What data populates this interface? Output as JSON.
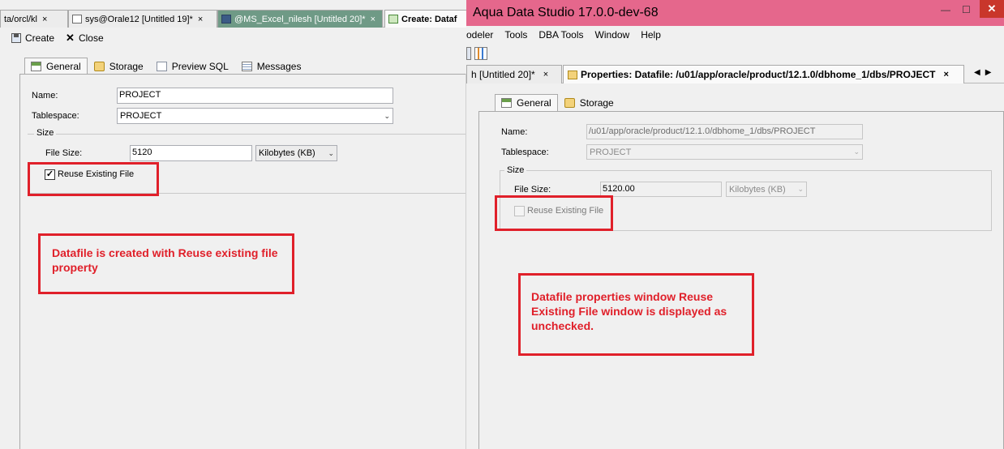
{
  "left": {
    "doc_tabs": [
      {
        "label": "ta/orcl/kl",
        "close": "×"
      },
      {
        "label": "sys@Orale12 [Untitled 19]*",
        "close": "×"
      },
      {
        "label": "@MS_Excel_nilesh [Untitled 20]*",
        "close": "×"
      },
      {
        "label": "Create: Dataf"
      }
    ],
    "toolbar": {
      "create_label": "Create",
      "close_label": "Close"
    },
    "tabs": [
      "General",
      "Storage",
      "Preview SQL",
      "Messages"
    ],
    "form": {
      "name_label": "Name:",
      "name_value": "PROJECT",
      "tablespace_label": "Tablespace:",
      "tablespace_value": "PROJECT",
      "size_legend": "Size",
      "file_size_label": "File Size:",
      "file_size_value": "5120",
      "unit_value": "Kilobytes (KB)",
      "reuse_label": "Reuse Existing File",
      "reuse_checked": true,
      "check_glyph": "✓"
    },
    "annotation": "Datafile is created with Reuse existing file property"
  },
  "right": {
    "title": "Aqua Data Studio 17.0.0-dev-68",
    "window_buttons": {
      "minimize": "—",
      "maximize": "☐",
      "close": "✕"
    },
    "menu": [
      "odeler",
      "Tools",
      "DBA Tools",
      "Window",
      "Help"
    ],
    "doc_tabs": [
      {
        "label": "h [Untitled 20]*",
        "close": "×"
      },
      {
        "label": "Properties: Datafile: /u01/app/oracle/product/12.1.0/dbhome_1/dbs/PROJECT",
        "close": "×"
      }
    ],
    "nav": {
      "prev": "◀",
      "next": "▶"
    },
    "tabs": [
      "General",
      "Storage"
    ],
    "form": {
      "name_label": "Name:",
      "name_value": "/u01/app/oracle/product/12.1.0/dbhome_1/dbs/PROJECT",
      "tablespace_label": "Tablespace:",
      "tablespace_value": "PROJECT",
      "size_legend": "Size",
      "file_size_label": "File Size:",
      "file_size_value": "5120.00",
      "unit_value": "Kilobytes (KB)",
      "reuse_label": "Reuse Existing File",
      "reuse_checked": false
    },
    "annotation": "Datafile properties window Reuse Existing File window is displayed as unchecked."
  },
  "colors": {
    "annotation_red": "#e0202a",
    "titlebar_pink": "#e5678c",
    "close_red": "#c9362b"
  }
}
